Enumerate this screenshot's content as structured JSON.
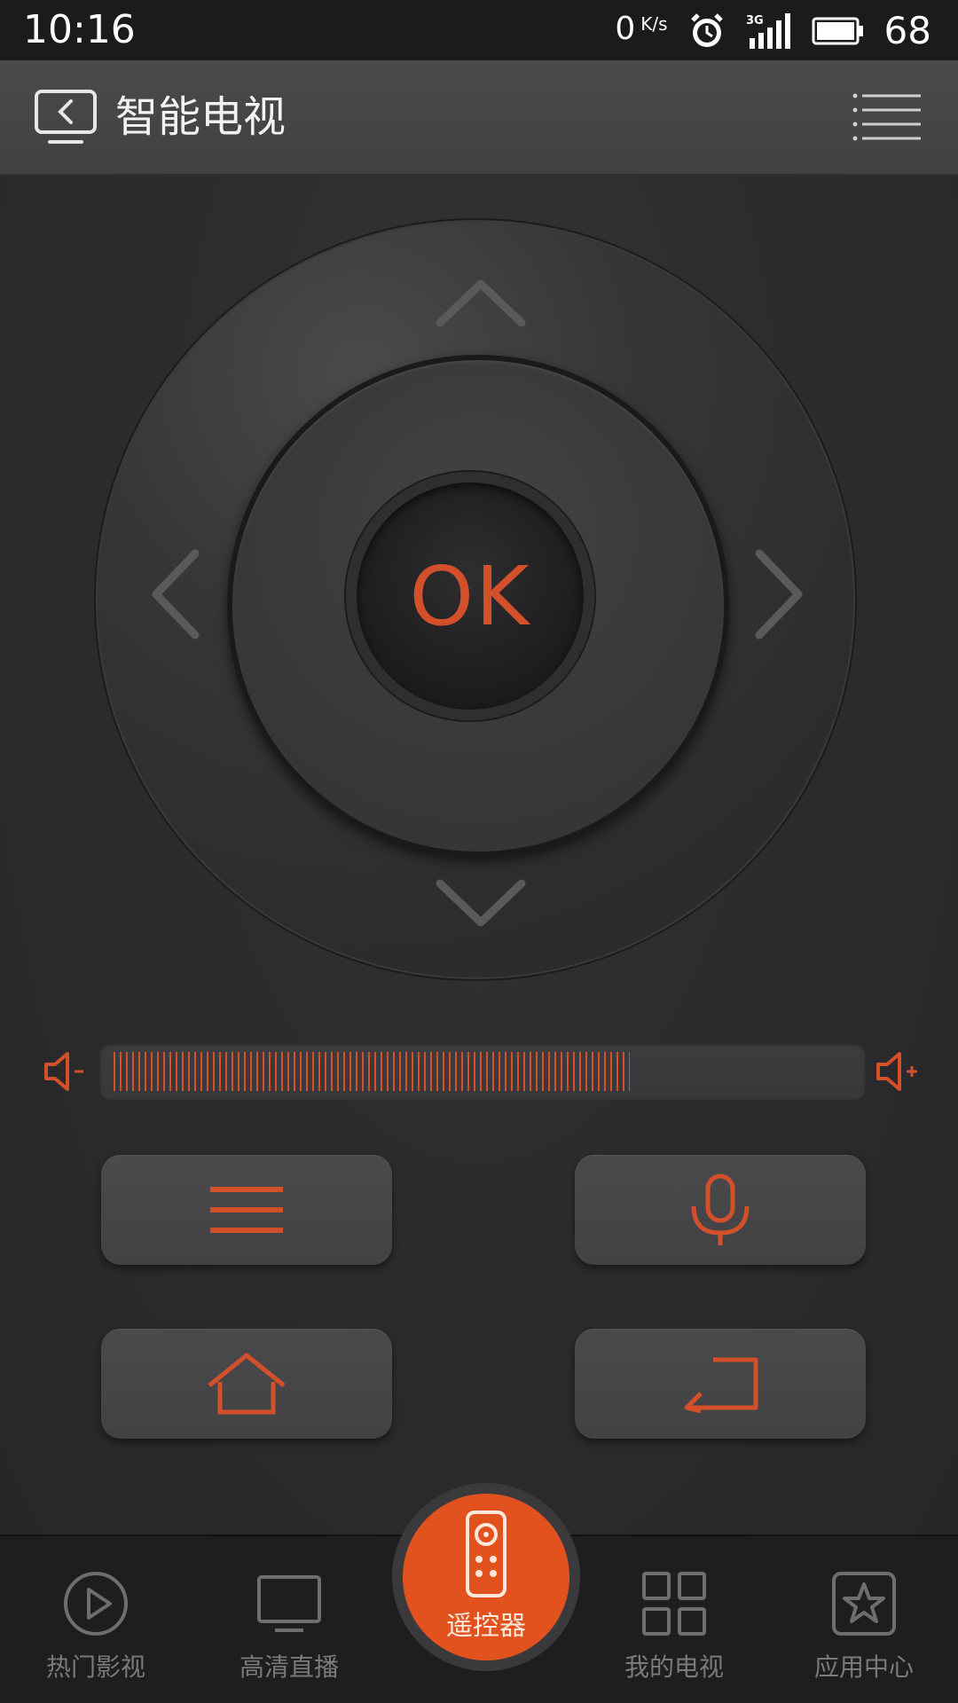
{
  "status_bar": {
    "time": "10:16",
    "speed_value": "0",
    "speed_unit": "K/s",
    "network": "3G",
    "battery": "68"
  },
  "header": {
    "title": "智能电视"
  },
  "remote": {
    "ok_label": "OK",
    "volume_level": 0.7
  },
  "bottom_nav": {
    "items": [
      {
        "label": "热门影视",
        "icon": "play-circle-icon"
      },
      {
        "label": "高清直播",
        "icon": "tv-icon"
      },
      {
        "label": "遥控器",
        "icon": "remote-icon",
        "active": true
      },
      {
        "label": "我的电视",
        "icon": "grid-icon"
      },
      {
        "label": "应用中心",
        "icon": "star-icon"
      }
    ]
  },
  "colors": {
    "accent": "#d3502a",
    "nav_active": "#e1521f",
    "background": "#2a2a2c"
  }
}
